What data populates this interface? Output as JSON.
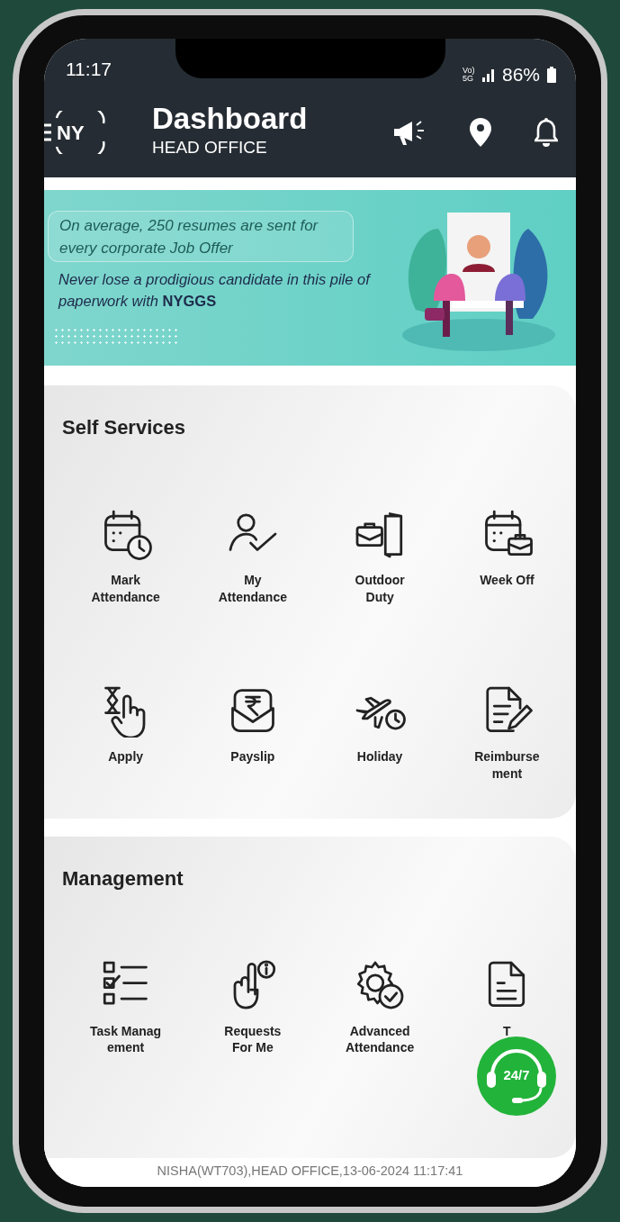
{
  "status_bar": {
    "time": "11:17",
    "network": "Vo) 5G",
    "battery": "86%"
  },
  "header": {
    "logo": "NY",
    "title": "Dashboard",
    "subtitle": "HEAD OFFICE"
  },
  "banner": {
    "lines": [
      "On average, 250 resumes are sent for every corporate Job Offer",
      "Never lose a prodigious candidate in this pile of paperwork with **NYGGS**"
    ]
  },
  "sections": [
    {
      "title": "Self Services",
      "items": [
        {
          "label": "Mark\nAttendance",
          "kind": "calendar-clock"
        },
        {
          "label": "My\nAttendance",
          "kind": "person-check"
        },
        {
          "label": "Outdoor\nDuty",
          "kind": "briefcase-door"
        },
        {
          "label": "Week Off",
          "kind": "calendar-briefcase"
        },
        {
          "label": "Apply",
          "kind": "hourglass-hand"
        },
        {
          "label": "Payslip",
          "kind": "rupee-envelope"
        },
        {
          "label": "Holiday",
          "kind": "plane-clock"
        },
        {
          "label": "Reimburse\nment",
          "kind": "document-pen"
        }
      ]
    },
    {
      "title": "Management",
      "items": [
        {
          "label": "Task Manag\nement",
          "kind": "checklist"
        },
        {
          "label": "Requests\nFor Me",
          "kind": "hand-info"
        },
        {
          "label": "Advanced\nAttendance",
          "kind": "gear-check"
        },
        {
          "label": "T",
          "kind": "document"
        }
      ]
    }
  ],
  "support_button": {
    "label": "24/7"
  },
  "footer": "NISHA(WT703),HEAD OFFICE,13-06-2024 11:17:41"
}
